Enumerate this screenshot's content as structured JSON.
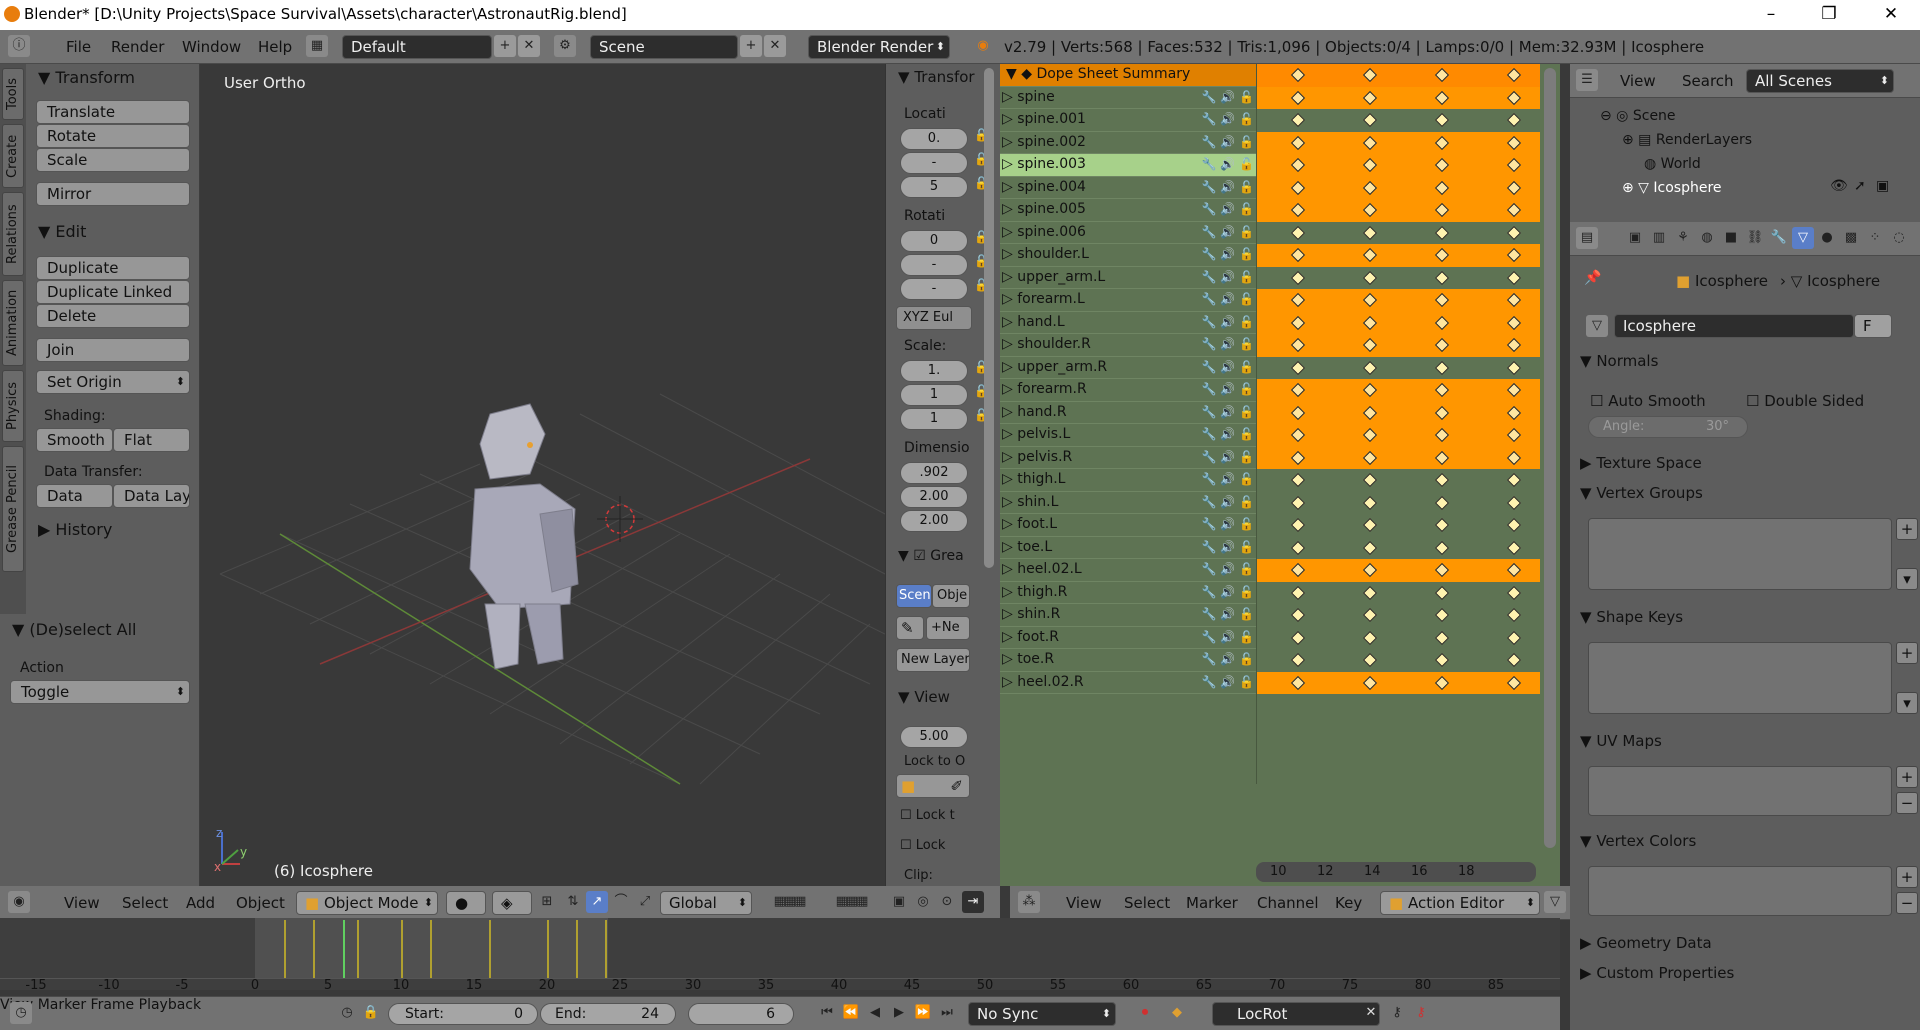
{
  "window": {
    "title": "Blender* [D:\\Unity Projects\\Space Survival\\Assets\\character\\AstronautRig.blend]",
    "minimize": "–",
    "restore": "❐",
    "close": "✕"
  },
  "info_bar": {
    "menus": [
      "File",
      "Render",
      "Window",
      "Help"
    ],
    "layout": "Default",
    "scene": "Scene",
    "engine": "Blender Render",
    "stats": "v2.79 | Verts:568 | Faces:532 | Tris:1,096 | Objects:0/4 | Lamps:0/0 | Mem:32.93M | Icosphere"
  },
  "tool_tabs": [
    "Tools",
    "Create",
    "Relations",
    "Animation",
    "Physics",
    "Grease Pencil"
  ],
  "tools": {
    "transform_title": "Transform",
    "translate": "Translate",
    "rotate": "Rotate",
    "scale": "Scale",
    "mirror": "Mirror",
    "edit_title": "Edit",
    "duplicate": "Duplicate",
    "duplicate_linked": "Duplicate Linked",
    "delete": "Delete",
    "join": "Join",
    "set_origin": "Set Origin",
    "shading_label": "Shading:",
    "smooth": "Smooth",
    "flat": "Flat",
    "data_transfer_label": "Data Transfer:",
    "data": "Data",
    "data_lay": "Data Lay",
    "history": "History",
    "deselect_title": "(De)select All",
    "action_label": "Action",
    "action_value": "Toggle"
  },
  "viewport": {
    "view_name": "User Ortho",
    "object_label": "(6) Icosphere",
    "axis_x": "x",
    "axis_y": "y",
    "axis_z": "z"
  },
  "npanel": {
    "transform": "Transfor",
    "location": "Locati",
    "loc": [
      "0.",
      "-",
      "5"
    ],
    "rotation": "Rotati",
    "rot": [
      "0",
      "-",
      "-"
    ],
    "euler": "XYZ Eul",
    "scale": "Scale:",
    "scl": [
      "1.",
      "1",
      "1"
    ],
    "dimensions": "Dimensio",
    "dim": [
      ".902",
      "2.00",
      "2.00"
    ],
    "grease": "Grea",
    "scene_btn": "Scen",
    "object_btn": "Obje",
    "new_btn": "Ne",
    "new_layer": "New Layer",
    "view": "View",
    "lens": "5.00",
    "lock_to": "Lock to O",
    "lock_t": "Lock t",
    "lock": "Lock",
    "clip": "Clip:"
  },
  "view3d_header": {
    "view": "View",
    "select": "Select",
    "add": "Add",
    "object": "Object",
    "mode": "Object Mode",
    "orientation": "Global"
  },
  "dopesheet": {
    "summary": "Dope Sheet Summary",
    "channels": [
      {
        "name": "spine",
        "orange": true
      },
      {
        "name": "spine.001",
        "orange": false
      },
      {
        "name": "spine.002",
        "orange": true
      },
      {
        "name": "spine.003",
        "orange": true,
        "selected": true
      },
      {
        "name": "spine.004",
        "orange": true
      },
      {
        "name": "spine.005",
        "orange": true
      },
      {
        "name": "spine.006",
        "orange": false
      },
      {
        "name": "shoulder.L",
        "orange": true
      },
      {
        "name": "upper_arm.L",
        "orange": false
      },
      {
        "name": "forearm.L",
        "orange": true
      },
      {
        "name": "hand.L",
        "orange": true
      },
      {
        "name": "shoulder.R",
        "orange": true
      },
      {
        "name": "upper_arm.R",
        "orange": false
      },
      {
        "name": "forearm.R",
        "orange": true
      },
      {
        "name": "hand.R",
        "orange": true
      },
      {
        "name": "pelvis.L",
        "orange": true
      },
      {
        "name": "pelvis.R",
        "orange": true
      },
      {
        "name": "thigh.L",
        "orange": false
      },
      {
        "name": "shin.L",
        "orange": false
      },
      {
        "name": "foot.L",
        "orange": false
      },
      {
        "name": "toe.L",
        "orange": false
      },
      {
        "name": "heel.02.L",
        "orange": true
      },
      {
        "name": "thigh.R",
        "orange": false
      },
      {
        "name": "shin.R",
        "orange": false
      },
      {
        "name": "foot.R",
        "orange": false
      },
      {
        "name": "toe.R",
        "orange": false
      },
      {
        "name": "heel.02.R",
        "orange": true
      }
    ],
    "frames": [
      "10",
      "12",
      "14",
      "16",
      "18"
    ],
    "header": {
      "view": "View",
      "select": "Select",
      "marker": "Marker",
      "channel": "Channel",
      "key": "Key",
      "mode": "Action Editor"
    }
  },
  "outliner": {
    "view": "View",
    "search": "Search",
    "filter": "All Scenes",
    "items": [
      "Scene",
      "RenderLayers",
      "World",
      "Icosphere"
    ]
  },
  "properties": {
    "breadcrumb_obj": "Icosphere",
    "breadcrumb_data": "Icosphere",
    "mesh_name": "Icosphere",
    "fake_user": "F",
    "normals": "Normals",
    "auto_smooth": "Auto Smooth",
    "double_sided": "Double Sided",
    "angle": "Angle:",
    "angle_val": "30°",
    "texture_space": "Texture Space",
    "vertex_groups": "Vertex Groups",
    "shape_keys": "Shape Keys",
    "uv_maps": "UV Maps",
    "vertex_colors": "Vertex Colors",
    "geometry_data": "Geometry Data",
    "custom_properties": "Custom Properties"
  },
  "timeline": {
    "ticks": [
      "-15",
      "-10",
      "-5",
      "0",
      "5",
      "10",
      "15",
      "20",
      "25",
      "30",
      "35",
      "40",
      "45",
      "50",
      "55",
      "60",
      "65",
      "70",
      "75",
      "80",
      "85"
    ],
    "view": "View",
    "marker": "Marker",
    "frame": "Frame",
    "playback": "Playback",
    "start_label": "Start:",
    "start": "0",
    "end_label": "End:",
    "end": "24",
    "current": "6",
    "sync": "No Sync",
    "keyset": "LocRot"
  }
}
